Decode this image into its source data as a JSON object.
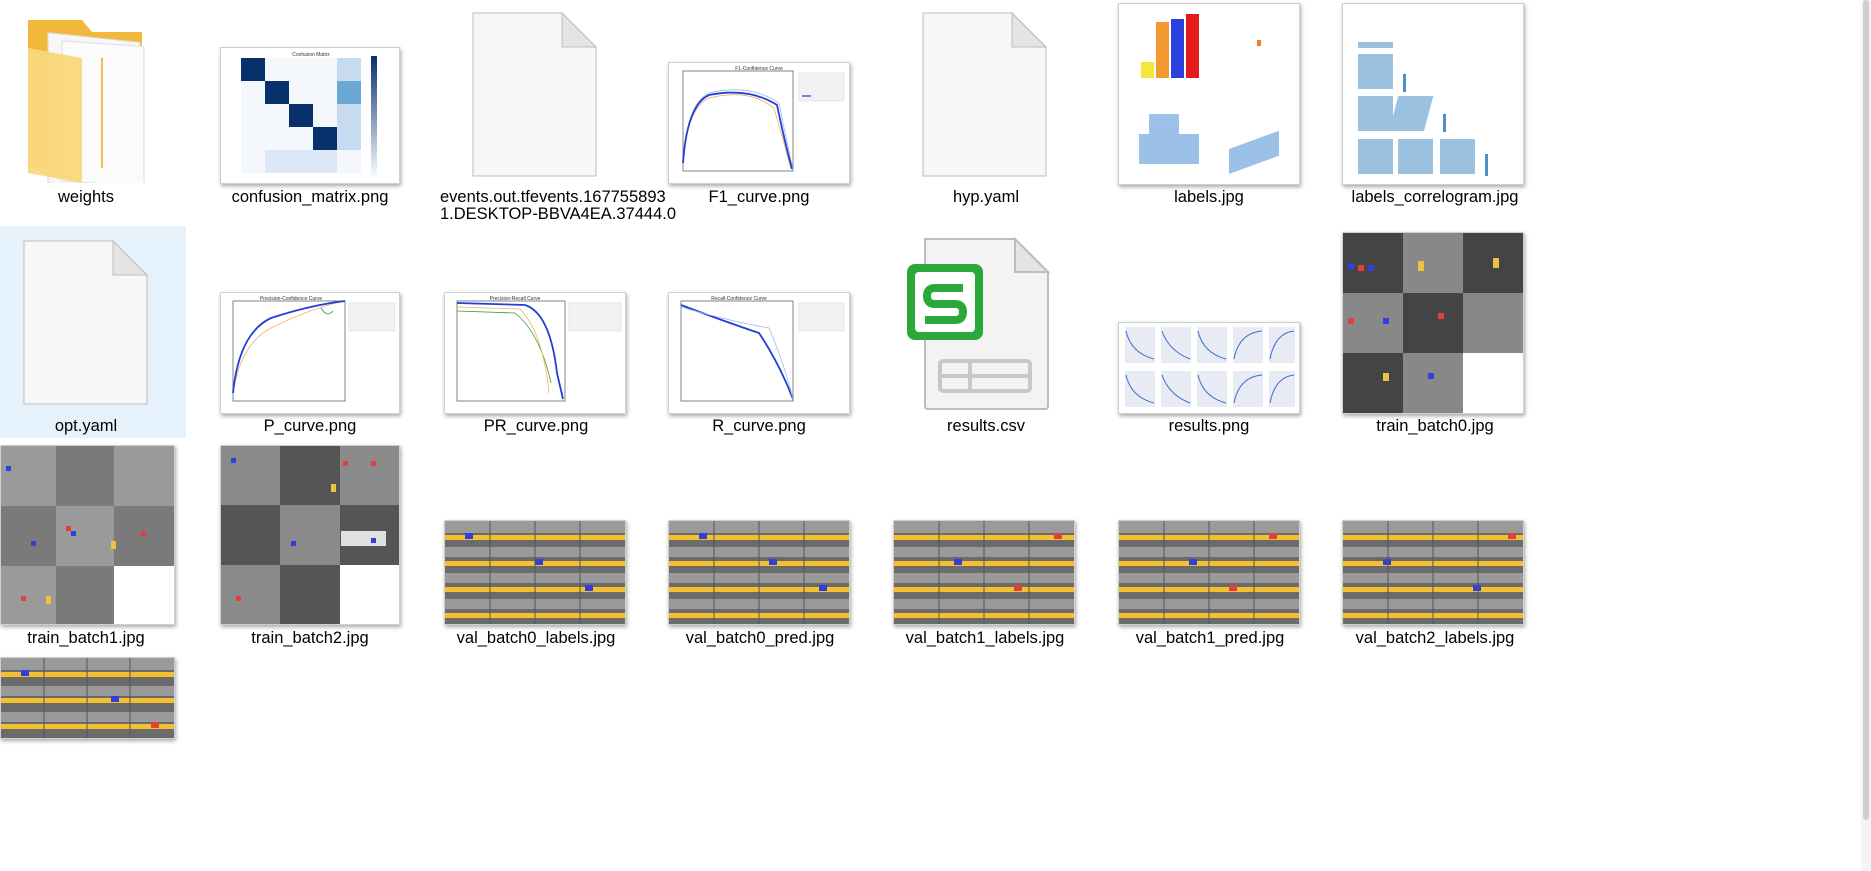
{
  "files": {
    "weights": "weights",
    "confusion_matrix": "confusion_matrix.png",
    "events_line1": "events.out.tfevents.167755893",
    "events_line2": "1.DESKTOP-BBVA4EA.37444.0",
    "f1_curve": "F1_curve.png",
    "hyp": "hyp.yaml",
    "labels": "labels.jpg",
    "labels_correlogram": "labels_correlogram.jpg",
    "opt": "opt.yaml",
    "p_curve": "P_curve.png",
    "pr_curve": "PR_curve.png",
    "r_curve": "R_curve.png",
    "results_csv": "results.csv",
    "results_png": "results.png",
    "train_batch0": "train_batch0.jpg",
    "train_batch1": "train_batch1.jpg",
    "train_batch2": "train_batch2.jpg",
    "val_batch0_labels": "val_batch0_labels.jpg",
    "val_batch0_pred": "val_batch0_pred.jpg",
    "val_batch1_labels": "val_batch1_labels.jpg",
    "val_batch1_pred": "val_batch1_pred.jpg",
    "val_batch2_labels": "val_batch2_labels.jpg"
  },
  "thumb_text": {
    "confusion_title": "Confusion Matrix",
    "f1_title": "F1-Confidence Curve",
    "p_title": "Precision-Confidence Curve",
    "pr_title": "Precision-Recall Curve",
    "r_title": "Recall-Confidence Curve"
  },
  "colors": {
    "selection": "#e5f1fb",
    "folder": "#f5c95a",
    "csv_green": "#2aa83a",
    "chart_blue": "#1f3fd6"
  }
}
